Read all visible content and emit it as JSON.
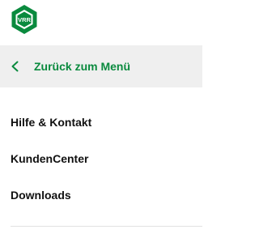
{
  "header": {
    "logo_text": "VRR",
    "logo_icon": "vrr-logo-icon"
  },
  "colors": {
    "brand_green": "#0a8a3e",
    "back_bar_bg": "#efefef",
    "menu_text": "#111111"
  },
  "back": {
    "label": "Zurück zum Menü",
    "icon": "chevron-left-icon"
  },
  "menu": {
    "items": [
      {
        "label": "Hilfe & Kontakt"
      },
      {
        "label": "KundenCenter"
      },
      {
        "label": "Downloads"
      }
    ]
  }
}
